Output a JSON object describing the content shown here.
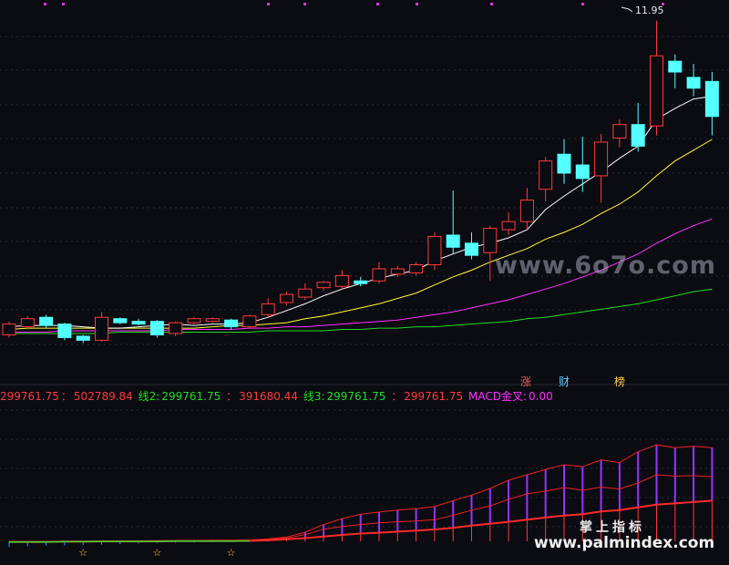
{
  "peak_label": "11.95",
  "info_bar": {
    "v1": "299761.75",
    "sep1": "：",
    "v2": "502789.84",
    "label2": "线2:",
    "v3": "299761.75",
    "sep3": "：",
    "v4": "391680.44",
    "label3": "线3:",
    "v5": "299761.75",
    "sep5": "：",
    "v6": "299761.75",
    "label_macd": "MACD金叉:",
    "v7": "0.00"
  },
  "tags": {
    "zhang": "涨",
    "cai": "财",
    "bang": "榜"
  },
  "watermarks": {
    "url1": "www.6o7o.com",
    "cn": "掌上指标",
    "url2": "www.palmindex.com"
  },
  "colors": {
    "up": "#ff3b3b",
    "down": "#54ffff",
    "ma5": "#ffffff",
    "ma10": "#ffff33",
    "ma20": "#ff33ff",
    "ma60": "#22dd22",
    "bg": "#0b0b12"
  },
  "chart_data": {
    "type": "candlestick",
    "candles": [
      [
        9.62,
        9.7,
        9.6,
        9.72
      ],
      [
        9.68,
        9.74,
        9.66,
        9.76
      ],
      [
        9.75,
        9.69,
        9.67,
        9.77
      ],
      [
        9.7,
        9.6,
        9.58,
        9.71
      ],
      [
        9.61,
        9.58,
        9.56,
        9.62
      ],
      [
        9.58,
        9.75,
        9.57,
        9.79
      ],
      [
        9.74,
        9.71,
        9.7,
        9.75
      ],
      [
        9.72,
        9.7,
        9.69,
        9.74
      ],
      [
        9.72,
        9.62,
        9.6,
        9.73
      ],
      [
        9.63,
        9.71,
        9.61,
        9.72
      ],
      [
        9.71,
        9.74,
        9.7,
        9.75
      ],
      [
        9.72,
        9.74,
        9.71,
        9.75
      ],
      [
        9.73,
        9.68,
        9.66,
        9.74
      ],
      [
        9.68,
        9.76,
        9.67,
        9.77
      ],
      [
        9.77,
        9.85,
        9.75,
        9.89
      ],
      [
        9.86,
        9.92,
        9.84,
        9.94
      ],
      [
        9.9,
        9.96,
        9.88,
        10.0
      ],
      [
        9.97,
        10.01,
        9.95,
        10.02
      ],
      [
        9.98,
        10.06,
        9.96,
        10.1
      ],
      [
        10.02,
        10.0,
        9.98,
        10.05
      ],
      [
        10.02,
        10.11,
        10.0,
        10.16
      ],
      [
        10.07,
        10.11,
        10.05,
        10.13
      ],
      [
        10.08,
        10.14,
        10.06,
        10.16
      ],
      [
        10.14,
        10.35,
        10.1,
        10.38
      ],
      [
        10.36,
        10.27,
        10.22,
        10.69
      ],
      [
        10.3,
        10.21,
        10.18,
        10.38
      ],
      [
        10.23,
        10.41,
        10.02,
        10.43
      ],
      [
        10.4,
        10.46,
        10.36,
        10.53
      ],
      [
        10.46,
        10.62,
        10.4,
        10.71
      ],
      [
        10.7,
        10.91,
        10.61,
        10.94
      ],
      [
        10.96,
        10.82,
        10.74,
        11.07
      ],
      [
        10.88,
        10.78,
        10.68,
        11.09
      ],
      [
        10.8,
        11.05,
        10.6,
        11.11
      ],
      [
        11.08,
        11.18,
        11.01,
        11.22
      ],
      [
        11.18,
        11.02,
        10.98,
        11.34
      ],
      [
        11.17,
        11.69,
        11.1,
        11.95
      ],
      [
        11.65,
        11.57,
        11.45,
        11.7
      ],
      [
        11.53,
        11.45,
        11.39,
        11.63
      ],
      [
        11.5,
        11.24,
        11.1,
        11.57
      ]
    ],
    "ma5": [
      9.68,
      9.69,
      9.69,
      9.69,
      9.68,
      9.67,
      9.67,
      9.68,
      9.69,
      9.7,
      9.69,
      9.7,
      9.7,
      9.71,
      9.75,
      9.8,
      9.85,
      9.91,
      9.96,
      10.0,
      10.04,
      10.07,
      10.1,
      10.17,
      10.22,
      10.27,
      10.3,
      10.34,
      10.4,
      10.55,
      10.65,
      10.74,
      10.83,
      10.93,
      11.02,
      11.22,
      11.3,
      11.37,
      11.39
    ],
    "ma10": [
      9.66,
      9.67,
      9.67,
      9.67,
      9.67,
      9.67,
      9.67,
      9.67,
      9.67,
      9.67,
      9.67,
      9.68,
      9.69,
      9.69,
      9.7,
      9.71,
      9.74,
      9.76,
      9.79,
      9.82,
      9.85,
      9.89,
      9.93,
      9.99,
      10.05,
      10.1,
      10.16,
      10.21,
      10.26,
      10.33,
      10.38,
      10.44,
      10.52,
      10.59,
      10.68,
      10.8,
      10.91,
      10.99,
      11.07
    ],
    "ma20": [
      9.64,
      9.64,
      9.64,
      9.65,
      9.65,
      9.65,
      9.65,
      9.65,
      9.65,
      9.66,
      9.66,
      9.66,
      9.66,
      9.67,
      9.67,
      9.68,
      9.68,
      9.69,
      9.7,
      9.71,
      9.72,
      9.73,
      9.75,
      9.77,
      9.79,
      9.82,
      9.85,
      9.88,
      9.92,
      9.96,
      10.0,
      10.05,
      10.1,
      10.16,
      10.22,
      10.3,
      10.37,
      10.43,
      10.48
    ],
    "ma60": [
      9.63,
      9.63,
      9.63,
      9.63,
      9.63,
      9.63,
      9.64,
      9.64,
      9.64,
      9.64,
      9.64,
      9.64,
      9.64,
      9.64,
      9.65,
      9.65,
      9.65,
      9.65,
      9.66,
      9.66,
      9.67,
      9.67,
      9.68,
      9.68,
      9.69,
      9.7,
      9.71,
      9.72,
      9.74,
      9.75,
      9.77,
      9.79,
      9.81,
      9.83,
      9.85,
      9.88,
      9.91,
      9.94,
      9.96
    ],
    "ylim": [
      9.4,
      12.05
    ],
    "indicator": {
      "ylim": [
        -60,
        500
      ],
      "line_top": [
        0,
        0,
        0,
        1,
        1,
        1,
        2,
        2,
        3,
        3,
        3,
        4,
        4,
        5,
        9,
        16,
        34,
        62,
        84,
        100,
        108,
        115,
        120,
        128,
        150,
        170,
        195,
        225,
        245,
        265,
        282,
        275,
        300,
        290,
        330,
        355,
        345,
        350,
        345
      ],
      "line_mid": [
        -1,
        -1,
        0,
        0,
        0,
        1,
        1,
        1,
        2,
        2,
        2,
        2,
        3,
        4,
        7,
        12,
        25,
        45,
        55,
        62,
        68,
        72,
        75,
        80,
        96,
        115,
        130,
        155,
        175,
        185,
        198,
        188,
        200,
        193,
        215,
        245,
        240,
        242,
        238
      ],
      "line_low": [
        -2,
        -2,
        -2,
        -1,
        -1,
        0,
        0,
        0,
        0,
        1,
        1,
        1,
        1,
        2,
        4,
        8,
        12,
        18,
        24,
        29,
        32,
        36,
        40,
        44,
        50,
        58,
        65,
        72,
        80,
        88,
        95,
        100,
        110,
        115,
        125,
        135,
        140,
        145,
        150
      ],
      "bars": [
        -20,
        -18,
        -16,
        -15,
        -14,
        -12,
        -10,
        -8,
        -6,
        -5,
        -4,
        -3,
        -2,
        -1,
        2,
        10,
        20,
        30,
        38,
        44,
        50,
        56,
        62,
        70,
        80,
        88,
        95,
        105,
        115,
        125,
        135,
        140,
        150,
        158,
        165,
        175,
        180,
        185,
        190
      ],
      "star_indices": [
        4,
        8,
        12
      ]
    }
  }
}
